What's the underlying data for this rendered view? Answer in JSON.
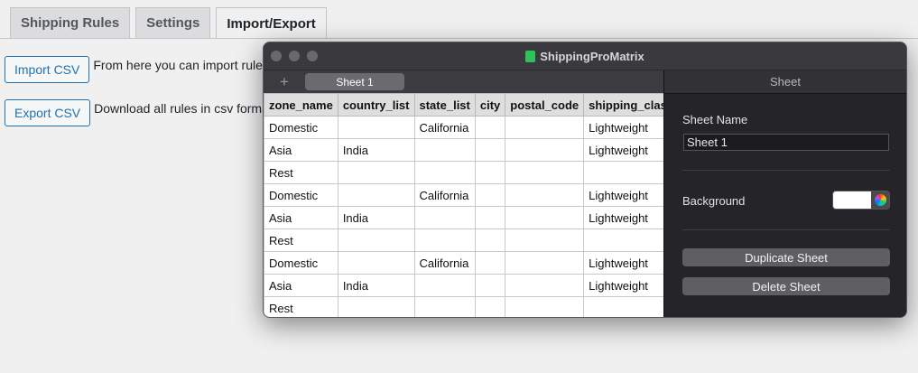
{
  "wp": {
    "tabs": [
      {
        "label": "Shipping Rules",
        "active": false
      },
      {
        "label": "Settings",
        "active": false
      },
      {
        "label": "Import/Export",
        "active": true
      }
    ],
    "import_button": "Import CSV",
    "import_text": "From here you can import rules",
    "export_button": "Export CSV",
    "export_text": "Download all rules in csv format"
  },
  "window": {
    "title": "ShippingProMatrix",
    "add_sheet_symbol": "+",
    "active_sheet_tab": "Sheet 1"
  },
  "table": {
    "columns": [
      "zone_name",
      "country_list",
      "state_list",
      "city",
      "postal_code",
      "shipping_class"
    ],
    "rows": [
      [
        "Domestic",
        "",
        "California",
        "",
        "",
        "Lightweight"
      ],
      [
        "Asia",
        "India",
        "",
        "",
        "",
        "Lightweight"
      ],
      [
        "Rest",
        "",
        "",
        "",
        "",
        ""
      ],
      [
        "Domestic",
        "",
        "California",
        "",
        "",
        "Lightweight"
      ],
      [
        "Asia",
        "India",
        "",
        "",
        "",
        "Lightweight"
      ],
      [
        "Rest",
        "",
        "",
        "",
        "",
        ""
      ],
      [
        "Domestic",
        "",
        "California",
        "",
        "",
        "Lightweight"
      ],
      [
        "Asia",
        "India",
        "",
        "",
        "",
        "Lightweight"
      ],
      [
        "Rest",
        "",
        "",
        "",
        "",
        ""
      ]
    ]
  },
  "panel": {
    "header": "Sheet",
    "sheet_name_label": "Sheet Name",
    "sheet_name_value": "Sheet 1",
    "background_label": "Background",
    "background_color": "#ffffff",
    "duplicate_button": "Duplicate Sheet",
    "delete_button": "Delete Sheet"
  }
}
